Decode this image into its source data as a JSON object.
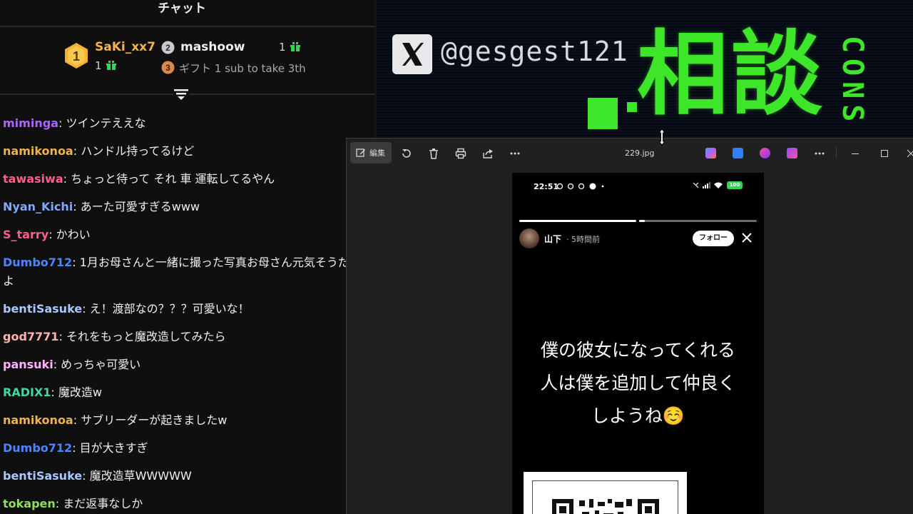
{
  "chat": {
    "title": "チャット",
    "leaderboard": {
      "first": {
        "rank": "1",
        "name": "SaKi_xx7",
        "count": "1"
      },
      "second": {
        "rank": "2",
        "name": "mashoow",
        "count": "1"
      },
      "third": {
        "rank": "3",
        "text": "ギフト 1 sub to take 3th"
      }
    },
    "messages": [
      {
        "user": "miminga",
        "color": "#b064ff",
        "text": "ツインテええな"
      },
      {
        "user": "namikonoa",
        "color": "#f0b24e",
        "text": "ハンドル持ってるけど"
      },
      {
        "user": "tawasiwa",
        "color": "#ff5e8a",
        "text": "ちょっと待って それ 車 運転してるやん"
      },
      {
        "user": "Nyan_Kichi",
        "color": "#7fa8ff",
        "text": "あーた可愛すぎるwww"
      },
      {
        "user": "S_tarry",
        "color": "#ff5e8a",
        "text": "かわい"
      },
      {
        "user": "Dumbo712",
        "color": "#4a86ff",
        "text": "1月お母さんと一緒に撮った写真お母さん元気そうだよ"
      },
      {
        "user": "bentiSasuke",
        "color": "#a8c8ff",
        "text": "え！渡部なの？？？可愛いな！"
      },
      {
        "user": "god7771",
        "color": "#ffb0b0",
        "text": "それをもっと魔改造してみたら"
      },
      {
        "user": "pansuki",
        "color": "#ffb3ff",
        "text": "めっちゃ可愛い"
      },
      {
        "user": "RADIX1",
        "color": "#45d6a6",
        "text": "魔改造w"
      },
      {
        "user": "namikonoa",
        "color": "#f0b24e",
        "text": "サブリーダーが起きましたw"
      },
      {
        "user": "Dumbo712",
        "color": "#4a86ff",
        "text": "目が大きすぎ"
      },
      {
        "user": "bentiSasuke",
        "color": "#a8c8ff",
        "text": "魔改造草WWWWW"
      },
      {
        "user": "tokapen",
        "color": "#8ee05a",
        "text": "まだ返事なしか"
      }
    ]
  },
  "overlay": {
    "handle": "@gesgest121",
    "big_text": "相談",
    "side_text": "CONS"
  },
  "viewer": {
    "edit_label": "編集",
    "filename": "229.jpg",
    "icons": [
      "rotate-icon",
      "trash-icon",
      "print-icon",
      "share-icon",
      "more-icon"
    ],
    "window_controls": [
      "minimize-icon",
      "maximize-icon",
      "close-icon"
    ]
  },
  "story": {
    "status_time": "22:51",
    "battery": "100",
    "user": "山下",
    "time_ago": "· 5時間前",
    "follow": "フォロー",
    "progress": {
      "segments": 2,
      "current_segment": 2,
      "current_fill": 0.05
    },
    "lines": [
      "僕の彼女になってくれる",
      "人は僕を追加して仲良く",
      "しようね☺️"
    ]
  }
}
